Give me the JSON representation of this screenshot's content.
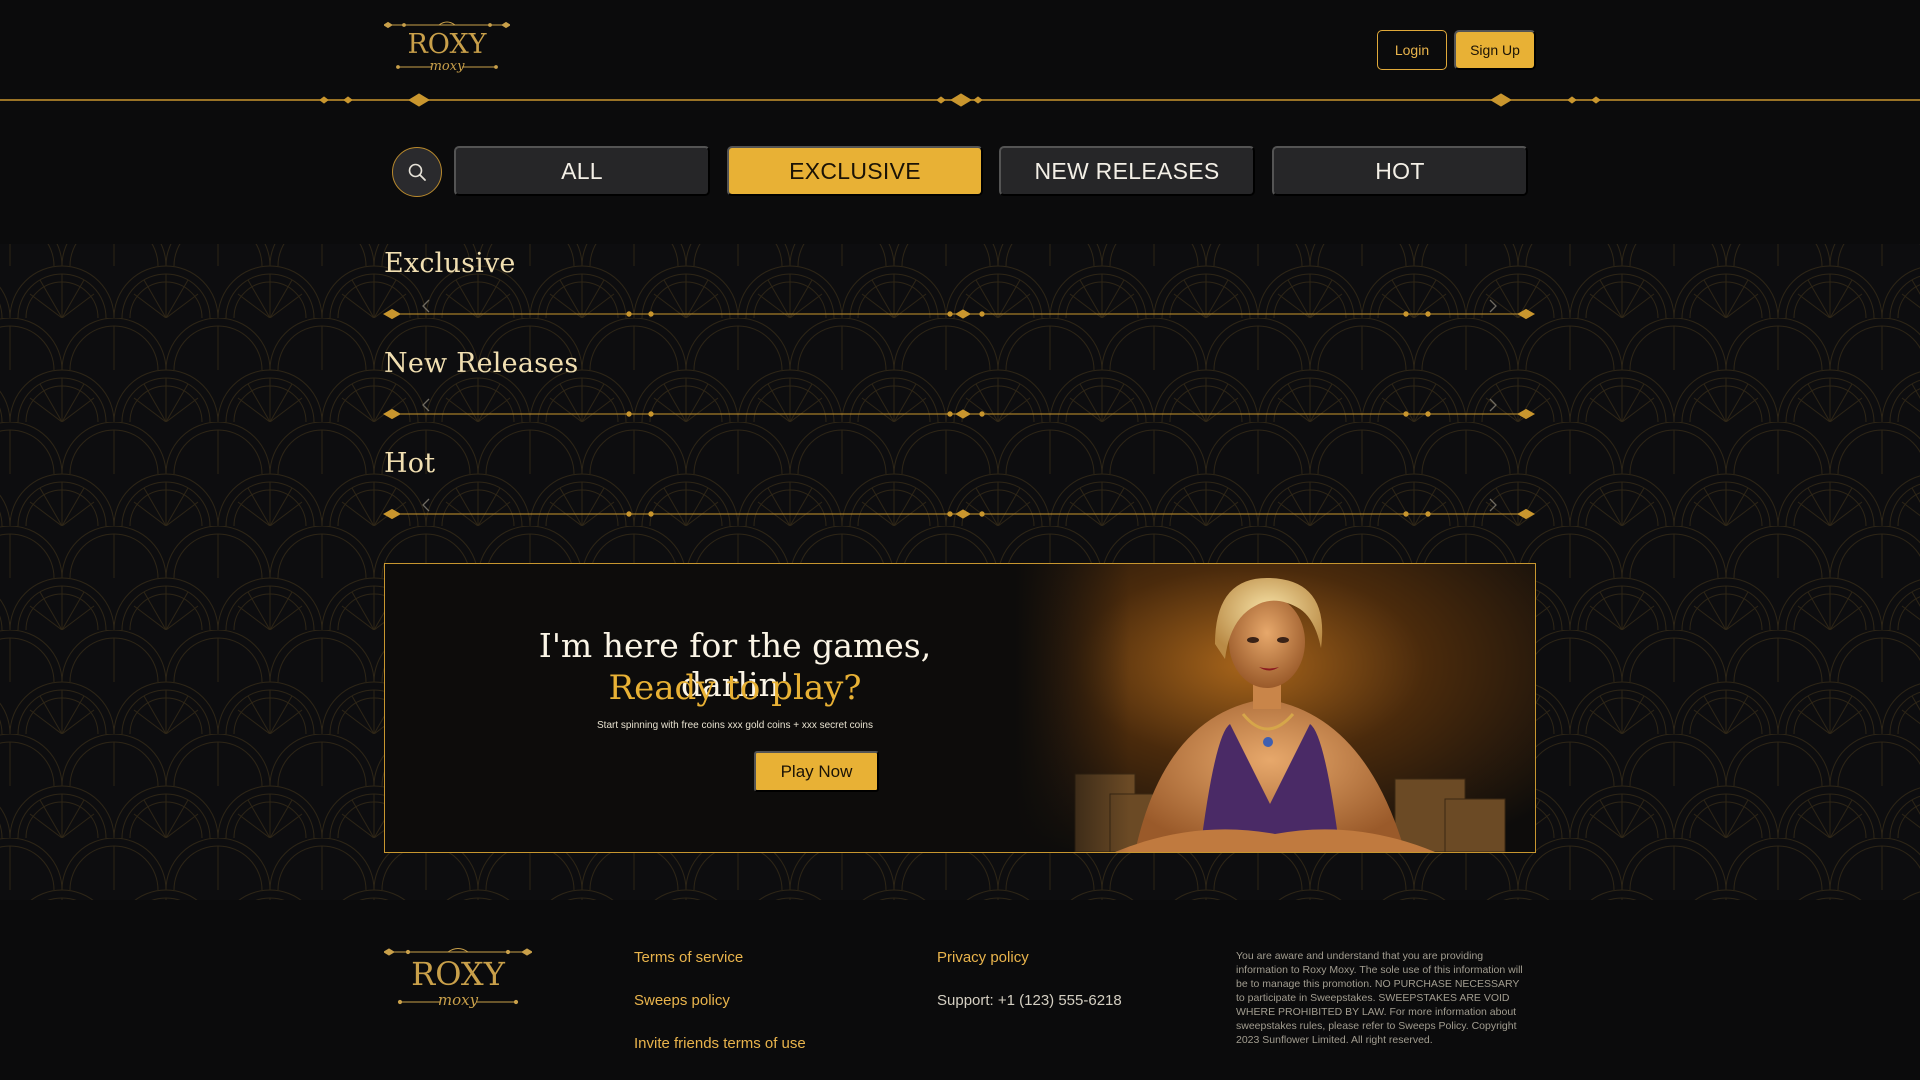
{
  "brand": {
    "logo_text_main": "ROXY",
    "logo_text_script": "moxy",
    "accent_color": "#e8b135",
    "background_color": "#0b0b0c"
  },
  "header": {
    "login_label": "Login",
    "signup_label": "Sign Up"
  },
  "categories": {
    "search_icon": "search-icon",
    "tabs": [
      {
        "label": "ALL",
        "active": false
      },
      {
        "label": "EXCLUSIVE",
        "active": true
      },
      {
        "label": "NEW RELEASES",
        "active": false
      },
      {
        "label": "HOT",
        "active": false
      }
    ]
  },
  "sections": [
    {
      "title": "Exclusive"
    },
    {
      "title": "New Releases"
    },
    {
      "title": "Hot"
    }
  ],
  "promo": {
    "headline": "I'm here for the games, darlin'",
    "subheadline": "Ready to play?",
    "description": "Start spinning with free coins xxx gold coins + xxx secret coins",
    "cta_label": "Play Now"
  },
  "footer": {
    "links_col1": [
      "Terms of service",
      "Sweeps policy",
      "Invite friends terms of use"
    ],
    "privacy_label": "Privacy policy",
    "support_text": "Support: +1 (123) 555-6218",
    "legal_text": "You are aware and understand that you are providing information to Roxy Moxy. The sole use of this information will be to manage this promotion. NO PURCHASE NECESSARY to participate in Sweepstakes. SWEEPSTAKES ARE VOID WHERE PROHIBITED BY LAW. For more information about sweepstakes rules, please refer to Sweeps Policy. Copyright 2023 Sunflower Limited. All right reserved."
  }
}
